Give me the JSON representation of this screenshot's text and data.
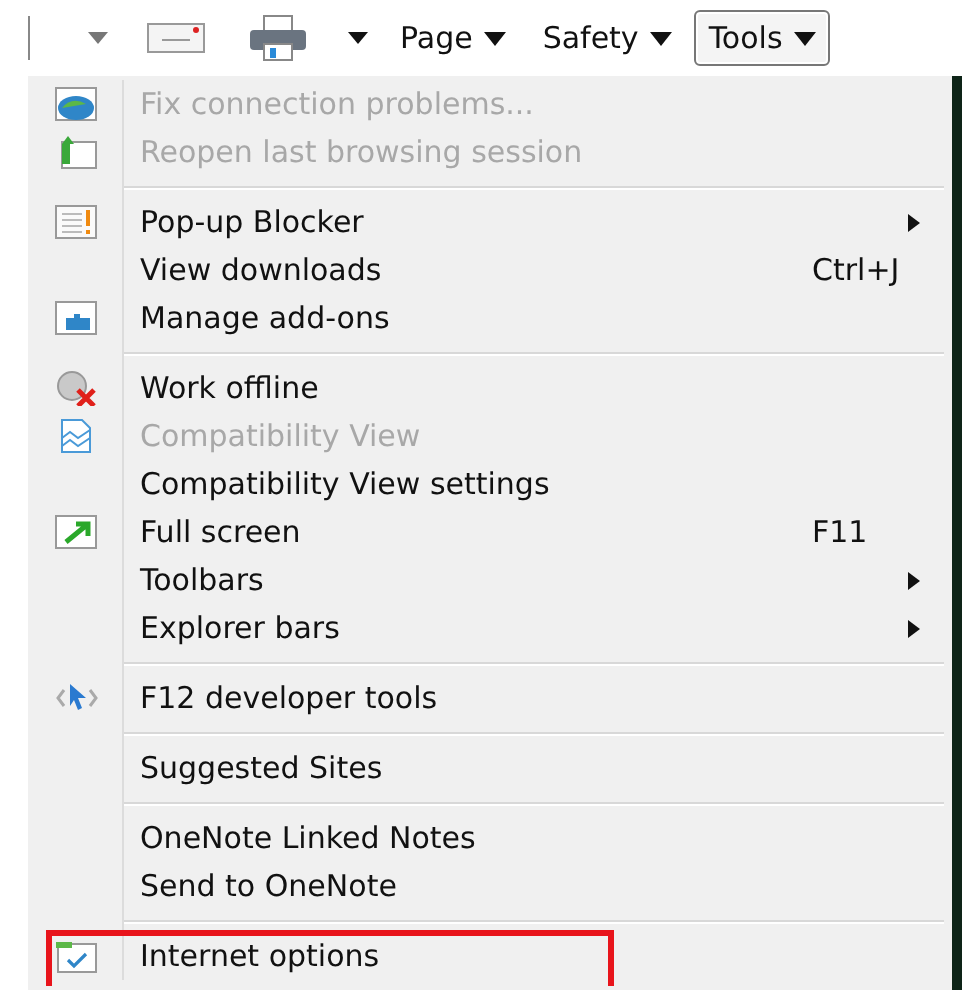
{
  "toolbar": {
    "buttons": [
      {
        "label": "Page",
        "pressed": false
      },
      {
        "label": "Safety",
        "pressed": false
      },
      {
        "label": "Tools",
        "pressed": true
      }
    ]
  },
  "menu": {
    "groups": [
      {
        "items": [
          {
            "label": "Fix connection problems...",
            "disabled": true
          },
          {
            "label": "Reopen last browsing session",
            "disabled": true
          }
        ]
      },
      {
        "items": [
          {
            "label": "Pop-up Blocker",
            "disabled": false,
            "submenu": true
          },
          {
            "label": "View downloads",
            "disabled": false,
            "shortcut": "Ctrl+J"
          },
          {
            "label": "Manage add-ons",
            "disabled": false
          }
        ]
      },
      {
        "items": [
          {
            "label": "Work offline",
            "disabled": false
          },
          {
            "label": "Compatibility View",
            "disabled": true
          },
          {
            "label": "Compatibility View settings",
            "disabled": false
          },
          {
            "label": "Full screen",
            "disabled": false,
            "shortcut": "F11"
          },
          {
            "label": "Toolbars",
            "disabled": false,
            "submenu": true
          },
          {
            "label": "Explorer bars",
            "disabled": false,
            "submenu": true
          }
        ]
      },
      {
        "items": [
          {
            "label": "F12 developer tools",
            "disabled": false
          }
        ]
      },
      {
        "items": [
          {
            "label": "Suggested Sites",
            "disabled": false
          }
        ]
      },
      {
        "items": [
          {
            "label": "OneNote Linked Notes",
            "disabled": false
          },
          {
            "label": "Send to OneNote",
            "disabled": false
          }
        ]
      },
      {
        "items": [
          {
            "label": "Internet options",
            "disabled": false,
            "highlighted": true
          }
        ]
      }
    ]
  }
}
